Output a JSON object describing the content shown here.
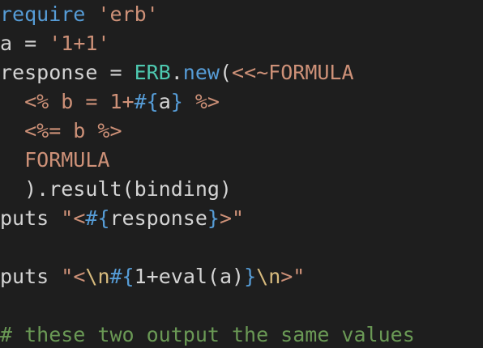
{
  "editor": {
    "lines": [
      {
        "tokens": [
          {
            "t": "require",
            "c": "kw"
          },
          {
            "t": " ",
            "c": "plain"
          },
          {
            "t": "'erb'",
            "c": "str"
          }
        ]
      },
      {
        "tokens": [
          {
            "t": "a",
            "c": "plain"
          },
          {
            "t": " = ",
            "c": "plain"
          },
          {
            "t": "'1+1'",
            "c": "str"
          }
        ]
      },
      {
        "tokens": [
          {
            "t": "response",
            "c": "plain"
          },
          {
            "t": " = ",
            "c": "plain"
          },
          {
            "t": "ERB",
            "c": "cls"
          },
          {
            "t": ".",
            "c": "plain"
          },
          {
            "t": "new",
            "c": "kw"
          },
          {
            "t": "(",
            "c": "plain"
          },
          {
            "t": "<<~FORMULA",
            "c": "str"
          }
        ]
      },
      {
        "tokens": [
          {
            "t": "  <% b = 1+",
            "c": "str"
          },
          {
            "t": "#{",
            "c": "punc"
          },
          {
            "t": "a",
            "c": "plain"
          },
          {
            "t": "}",
            "c": "punc"
          },
          {
            "t": " %>",
            "c": "str"
          }
        ]
      },
      {
        "tokens": [
          {
            "t": "  <%= b %>",
            "c": "str"
          }
        ]
      },
      {
        "tokens": [
          {
            "t": "  FORMULA",
            "c": "str"
          }
        ]
      },
      {
        "tokens": [
          {
            "t": "  ).result(binding)",
            "c": "plain"
          }
        ]
      },
      {
        "tokens": [
          {
            "t": "puts",
            "c": "plain"
          },
          {
            "t": " ",
            "c": "plain"
          },
          {
            "t": "\"<",
            "c": "str"
          },
          {
            "t": "#{",
            "c": "punc"
          },
          {
            "t": "response",
            "c": "plain"
          },
          {
            "t": "}",
            "c": "punc"
          },
          {
            "t": ">\"",
            "c": "str"
          }
        ]
      },
      {
        "tokens": []
      },
      {
        "tokens": [
          {
            "t": "puts",
            "c": "plain"
          },
          {
            "t": " ",
            "c": "plain"
          },
          {
            "t": "\"<",
            "c": "str"
          },
          {
            "t": "\\n",
            "c": "esc"
          },
          {
            "t": "#{",
            "c": "punc"
          },
          {
            "t": "1+eval(a)",
            "c": "plain"
          },
          {
            "t": "}",
            "c": "punc"
          },
          {
            "t": "\\n",
            "c": "esc"
          },
          {
            "t": ">\"",
            "c": "str"
          }
        ]
      },
      {
        "tokens": []
      },
      {
        "tokens": [
          {
            "t": "# these two output the same values",
            "c": "cmt"
          }
        ]
      }
    ]
  }
}
